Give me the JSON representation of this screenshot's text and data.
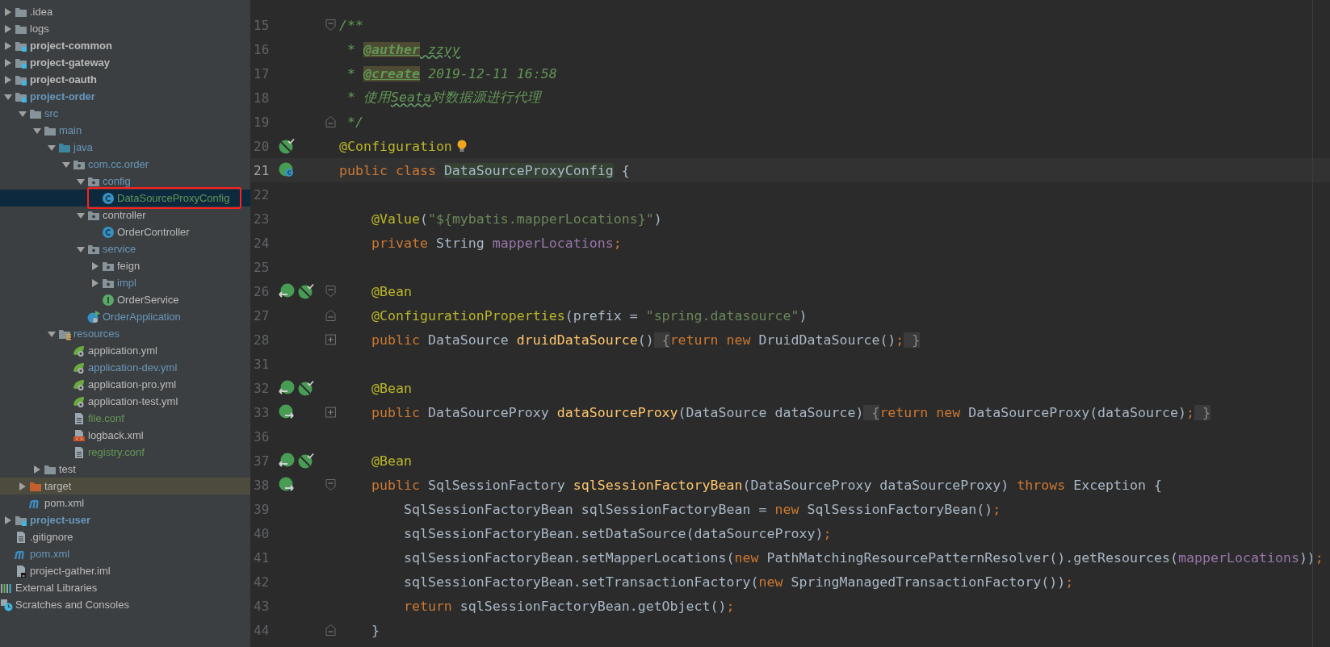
{
  "project_tree": {
    "items": [
      {
        "kind": "project-root",
        "children": [
          {
            "label": ".idea",
            "kind": "folder",
            "expanded": false,
            "selected": false,
            "color": "#bbbbbb"
          },
          {
            "label": "logs",
            "kind": "folder",
            "expanded": false,
            "selected": false,
            "color": "#bbbbbb"
          },
          {
            "label": "project-common",
            "kind": "module",
            "expanded": false,
            "selected": false,
            "color": "#bbbbbb"
          },
          {
            "label": "project-gateway",
            "kind": "module",
            "expanded": false,
            "selected": false,
            "color": "#bbbbbb"
          },
          {
            "label": "project-oauth",
            "kind": "module",
            "expanded": false,
            "selected": false,
            "color": "#bbbbbb"
          },
          {
            "label": "project-order",
            "kind": "module",
            "expanded": true,
            "selected": false,
            "color": "#6897bb",
            "children": [
              {
                "label": "src",
                "kind": "folder",
                "expanded": true,
                "selected": false,
                "color": "#6897bb",
                "children": [
                  {
                    "label": "main",
                    "kind": "folder",
                    "expanded": true,
                    "selected": false,
                    "color": "#6897bb",
                    "children": [
                      {
                        "label": "java",
                        "kind": "source-folder",
                        "expanded": true,
                        "selected": false,
                        "color": "#6897bb",
                        "children": [
                          {
                            "label": "com.cc.order",
                            "kind": "package",
                            "expanded": true,
                            "selected": false,
                            "color": "#6897bb",
                            "children": [
                              {
                                "label": "config",
                                "kind": "package",
                                "expanded": true,
                                "selected": false,
                                "color": "#6897bb",
                                "children": [
                                  {
                                    "label": "DataSourceProxyConfig",
                                    "kind": "class",
                                    "selected": true,
                                    "annotated": true,
                                    "color": "#629755"
                                  }
                                ]
                              },
                              {
                                "label": "controller",
                                "kind": "package",
                                "expanded": true,
                                "selected": false,
                                "color": "#bbbbbb",
                                "children": [
                                  {
                                    "label": "OrderController",
                                    "kind": "class",
                                    "selected": false,
                                    "color": "#bbbbbb"
                                  }
                                ]
                              },
                              {
                                "label": "service",
                                "kind": "package",
                                "expanded": true,
                                "selected": false,
                                "color": "#6897bb",
                                "children": [
                                  {
                                    "label": "feign",
                                    "kind": "package",
                                    "expanded": false,
                                    "selected": false,
                                    "color": "#bbbbbb"
                                  },
                                  {
                                    "label": "impl",
                                    "kind": "package",
                                    "expanded": false,
                                    "selected": false,
                                    "color": "#6897bb"
                                  },
                                  {
                                    "label": "OrderService",
                                    "kind": "interface",
                                    "selected": false,
                                    "color": "#bbbbbb"
                                  }
                                ]
                              },
                              {
                                "label": "OrderApplication",
                                "kind": "boot-class",
                                "selected": false,
                                "color": "#6897bb"
                              }
                            ]
                          }
                        ]
                      },
                      {
                        "label": "resources",
                        "kind": "resources-folder",
                        "expanded": true,
                        "selected": false,
                        "color": "#6897bb",
                        "children": [
                          {
                            "label": "application.yml",
                            "kind": "spring-yml",
                            "selected": false,
                            "color": "#bbbbbb"
                          },
                          {
                            "label": "application-dev.yml",
                            "kind": "spring-yml",
                            "selected": false,
                            "color": "#6897bb"
                          },
                          {
                            "label": "application-pro.yml",
                            "kind": "spring-yml",
                            "selected": false,
                            "color": "#bbbbbb"
                          },
                          {
                            "label": "application-test.yml",
                            "kind": "spring-yml",
                            "selected": false,
                            "color": "#bbbbbb"
                          },
                          {
                            "label": "file.conf",
                            "kind": "text-file",
                            "selected": false,
                            "color": "#629755"
                          },
                          {
                            "label": "logback.xml",
                            "kind": "xml-file",
                            "selected": false,
                            "color": "#bbbbbb"
                          },
                          {
                            "label": "registry.conf",
                            "kind": "text-file",
                            "selected": false,
                            "color": "#629755"
                          }
                        ]
                      }
                    ]
                  },
                  {
                    "label": "test",
                    "kind": "folder",
                    "expanded": false,
                    "selected": false,
                    "color": "#bbbbbb"
                  }
                ]
              },
              {
                "label": "target",
                "kind": "excluded-folder",
                "expanded": false,
                "selected": false,
                "color": "#bbbbbb"
              },
              {
                "label": "pom.xml",
                "kind": "maven",
                "selected": false,
                "color": "#bbbbbb"
              }
            ]
          },
          {
            "label": "project-user",
            "kind": "module",
            "expanded": false,
            "selected": false,
            "color": "#6897bb"
          },
          {
            "label": ".gitignore",
            "kind": "text-file",
            "selected": false,
            "color": "#bbbbbb"
          },
          {
            "label": "pom.xml",
            "kind": "maven",
            "selected": false,
            "color": "#6897bb"
          },
          {
            "label": "project-gather.iml",
            "kind": "iml-file",
            "selected": false,
            "color": "#bbbbbb"
          }
        ]
      },
      {
        "label": "External Libraries",
        "kind": "libraries",
        "selected": false,
        "color": "#bbbbbb"
      },
      {
        "label": "Scratches and Consoles",
        "kind": "scratches",
        "selected": false,
        "color": "#bbbbbb"
      }
    ]
  },
  "editor": {
    "lines": [
      {
        "number": "15",
        "fold": {
          "kind": "start"
        },
        "tokens": [
          {
            "text": "/**",
            "kind": "comment"
          }
        ]
      },
      {
        "number": "16",
        "tokens": [
          {
            "text": " * ",
            "kind": "comment"
          },
          {
            "text": "@auther",
            "kind": "doc-tag"
          },
          {
            "text": " zzyy",
            "kind": "comment-typo"
          }
        ]
      },
      {
        "number": "17",
        "tokens": [
          {
            "text": " * ",
            "kind": "comment"
          },
          {
            "text": "@create",
            "kind": "doc-tag"
          },
          {
            "text": " 2019-12-11 16:58",
            "kind": "comment"
          }
        ]
      },
      {
        "number": "18",
        "tokens": [
          {
            "text": " * 使用",
            "kind": "comment"
          },
          {
            "text": "Seata",
            "kind": "comment-typo"
          },
          {
            "text": "对数据源进行代理",
            "kind": "comment"
          }
        ]
      },
      {
        "number": "19",
        "fold": {
          "kind": "end"
        },
        "tokens": [
          {
            "text": " */",
            "kind": "comment"
          }
        ]
      },
      {
        "number": "20",
        "gutter": [
          {
            "kind": "bean-check"
          }
        ],
        "intention_bulb": true,
        "tokens": [
          {
            "text": "@Configuration",
            "kind": "annotation"
          }
        ]
      },
      {
        "number": "21",
        "gutter": [
          {
            "kind": "class-bean"
          }
        ],
        "current": true,
        "tokens": [
          {
            "text": "public class ",
            "kind": "keyword"
          },
          {
            "text": "DataSourceProxyConfig",
            "kind": "class-highlight"
          },
          {
            "text": " {",
            "kind": "plain"
          }
        ]
      },
      {
        "number": "22"
      },
      {
        "number": "23",
        "tokens": [
          {
            "text": "    @Value",
            "kind": "annotation"
          },
          {
            "text": "(",
            "kind": "plain"
          },
          {
            "text": "\"${mybatis.mapperLocations}\"",
            "kind": "string"
          },
          {
            "text": ")",
            "kind": "plain"
          }
        ]
      },
      {
        "number": "24",
        "tokens": [
          {
            "text": "    private",
            "kind": "keyword"
          },
          {
            "text": " String ",
            "kind": "plain"
          },
          {
            "text": "mapperLocations",
            "kind": "field"
          },
          {
            "text": ";",
            "kind": "keyword"
          }
        ]
      },
      {
        "number": "25"
      },
      {
        "number": "26",
        "gutter": [
          {
            "kind": "bean-left"
          },
          {
            "kind": "bean-check"
          }
        ],
        "fold": {
          "kind": "start"
        },
        "tokens": [
          {
            "text": "    @Bean",
            "kind": "annotation"
          }
        ]
      },
      {
        "number": "27",
        "fold": {
          "kind": "end"
        },
        "tokens": [
          {
            "text": "    @ConfigurationProperties",
            "kind": "annotation"
          },
          {
            "text": "(prefix = ",
            "kind": "plain"
          },
          {
            "text": "\"spring.datasource\"",
            "kind": "string"
          },
          {
            "text": ")",
            "kind": "plain"
          }
        ]
      },
      {
        "number": "28",
        "fold": {
          "kind": "collapsed"
        },
        "tokens": [
          {
            "text": "    public",
            "kind": "keyword"
          },
          {
            "text": " DataSource ",
            "kind": "plain"
          },
          {
            "text": "druidDataSource",
            "kind": "method"
          },
          {
            "text": "()",
            "kind": "plain"
          },
          {
            "text": " {",
            "kind": "fold-brace"
          },
          {
            "text": "return new",
            "kind": "keyword"
          },
          {
            "text": " DruidDataSource()",
            "kind": "plain"
          },
          {
            "text": ";",
            "kind": "keyword"
          },
          {
            "text": " }",
            "kind": "fold-brace"
          }
        ]
      },
      {
        "number": "31"
      },
      {
        "number": "32",
        "gutter": [
          {
            "kind": "bean-left"
          },
          {
            "kind": "bean-check"
          }
        ],
        "tokens": [
          {
            "text": "    @Bean",
            "kind": "annotation"
          }
        ]
      },
      {
        "number": "33",
        "gutter": [
          {
            "kind": "bean-right"
          }
        ],
        "fold": {
          "kind": "collapsed"
        },
        "tokens": [
          {
            "text": "    public",
            "kind": "keyword"
          },
          {
            "text": " DataSourceProxy ",
            "kind": "plain"
          },
          {
            "text": "dataSourceProxy",
            "kind": "method"
          },
          {
            "text": "(DataSource dataSource)",
            "kind": "plain"
          },
          {
            "text": " {",
            "kind": "fold-brace"
          },
          {
            "text": "return new",
            "kind": "keyword"
          },
          {
            "text": " DataSourceProxy(dataSource)",
            "kind": "plain"
          },
          {
            "text": ";",
            "kind": "keyword"
          },
          {
            "text": " }",
            "kind": "fold-brace"
          }
        ]
      },
      {
        "number": "36"
      },
      {
        "number": "37",
        "gutter": [
          {
            "kind": "bean-left"
          },
          {
            "kind": "bean-check"
          }
        ],
        "tokens": [
          {
            "text": "    @Bean",
            "kind": "annotation"
          }
        ]
      },
      {
        "number": "38",
        "gutter": [
          {
            "kind": "bean-right"
          }
        ],
        "fold": {
          "kind": "start"
        },
        "tokens": [
          {
            "text": "    public",
            "kind": "keyword"
          },
          {
            "text": " SqlSessionFactory ",
            "kind": "plain"
          },
          {
            "text": "sqlSessionFactoryBean",
            "kind": "method"
          },
          {
            "text": "(DataSourceProxy dataSourceProxy) ",
            "kind": "plain"
          },
          {
            "text": "throws",
            "kind": "keyword"
          },
          {
            "text": " Exception {",
            "kind": "plain"
          }
        ]
      },
      {
        "number": "39",
        "tokens": [
          {
            "text": "        SqlSessionFactoryBean sqlSessionFactoryBean = ",
            "kind": "plain"
          },
          {
            "text": "new",
            "kind": "keyword"
          },
          {
            "text": " SqlSessionFactoryBean()",
            "kind": "plain"
          },
          {
            "text": ";",
            "kind": "keyword"
          }
        ]
      },
      {
        "number": "40",
        "tokens": [
          {
            "text": "        sqlSessionFactoryBean.setDataSource(dataSourceProxy)",
            "kind": "plain"
          },
          {
            "text": ";",
            "kind": "keyword"
          }
        ]
      },
      {
        "number": "41",
        "tokens": [
          {
            "text": "        sqlSessionFactoryBean.setMapperLocations(",
            "kind": "plain"
          },
          {
            "text": "new",
            "kind": "keyword"
          },
          {
            "text": " PathMatchingResourcePatternResolver().getResources(",
            "kind": "plain"
          },
          {
            "text": "mapperLocations",
            "kind": "field"
          },
          {
            "text": "))",
            "kind": "plain"
          },
          {
            "text": ";",
            "kind": "keyword"
          }
        ]
      },
      {
        "number": "42",
        "tokens": [
          {
            "text": "        sqlSessionFactoryBean.setTransactionFactory(",
            "kind": "plain"
          },
          {
            "text": "new",
            "kind": "keyword"
          },
          {
            "text": " SpringManagedTransactionFactory())",
            "kind": "plain"
          },
          {
            "text": ";",
            "kind": "keyword"
          }
        ]
      },
      {
        "number": "43",
        "tokens": [
          {
            "text": "        return",
            "kind": "keyword"
          },
          {
            "text": " sqlSessionFactoryBean.getObject()",
            "kind": "plain"
          },
          {
            "text": ";",
            "kind": "keyword"
          }
        ]
      },
      {
        "number": "44",
        "fold": {
          "kind": "end"
        },
        "tokens": [
          {
            "text": "    }",
            "kind": "plain"
          }
        ]
      }
    ]
  }
}
